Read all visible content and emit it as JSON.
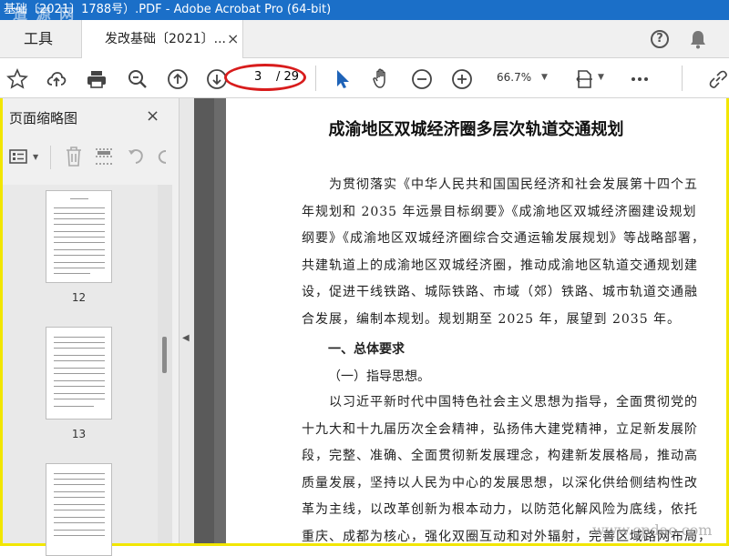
{
  "window": {
    "title": "基础〔2021〕1788号）.PDF - Adobe Acrobat Pro (64-bit)"
  },
  "watermark_top": "道 源 网",
  "tabs": {
    "tools": "工具",
    "document": "发改基础〔2021〕...",
    "close": "×"
  },
  "toolbar": {
    "page_current": "3",
    "page_total": "/ 29",
    "zoom": "66.7%",
    "zoom_caret": "▼"
  },
  "icons": [
    "star-icon",
    "upload-cloud-icon",
    "print-icon",
    "zoom-search-icon",
    "arrow-up-icon",
    "arrow-down-icon",
    "pointer-icon",
    "hand-icon",
    "zoom-out-icon",
    "zoom-in-icon",
    "page-fit-icon",
    "more-icon",
    "link-icon",
    "help-icon",
    "bell-icon"
  ],
  "sidebar": {
    "title": "页面缩略图",
    "close": "×",
    "thumbnails": [
      {
        "label": "12"
      },
      {
        "label": "13"
      },
      {
        "label": ""
      }
    ]
  },
  "document": {
    "title": "成渝地区双城经济圈多层次轨道交通规划",
    "para1": [
      "为贯彻落实《中华人民共和国国民经济和社会发展第十四个五",
      "年规划和 2035 年远景目标纲要》《成渝地区双城经济圈建设规划",
      "纲要》《成渝地区双城经济圈综合交通运输发展规划》等战略部署，",
      "共建轨道上的成渝地区双城经济圈，推动成渝地区轨道交通规划建",
      "设，促进干线铁路、城际铁路、市域（郊）铁路、城市轨道交通融",
      "合发展，编制本规划。规划期至 2025 年，展望到 2035 年。"
    ],
    "heading1": "一、总体要求",
    "heading2": "（一）指导思想。",
    "para2": [
      "以习近平新时代中国特色社会主义思想为指导，全面贯彻党的",
      "十九大和十九届历次全会精神，弘扬伟大建党精神，立足新发展阶",
      "段，完整、准确、全面贯彻新发展理念，构建新发展格局，推动高",
      "质量发展，坚持以人民为中心的发展思想，以深化供给侧结构性改",
      "革为主线，以改革创新为根本动力，以防范化解风险为底线，依托",
      "重庆、成都为核心，强化双圈互动和对外辐射，完善区域路网布局，"
    ]
  },
  "watermark_bottom": "www.cpdao.com",
  "colors": {
    "titlebar": "#1b6fc8",
    "frame": "#f2e600",
    "highlight": "#d81c1c",
    "pointer": "#1e63b8"
  }
}
